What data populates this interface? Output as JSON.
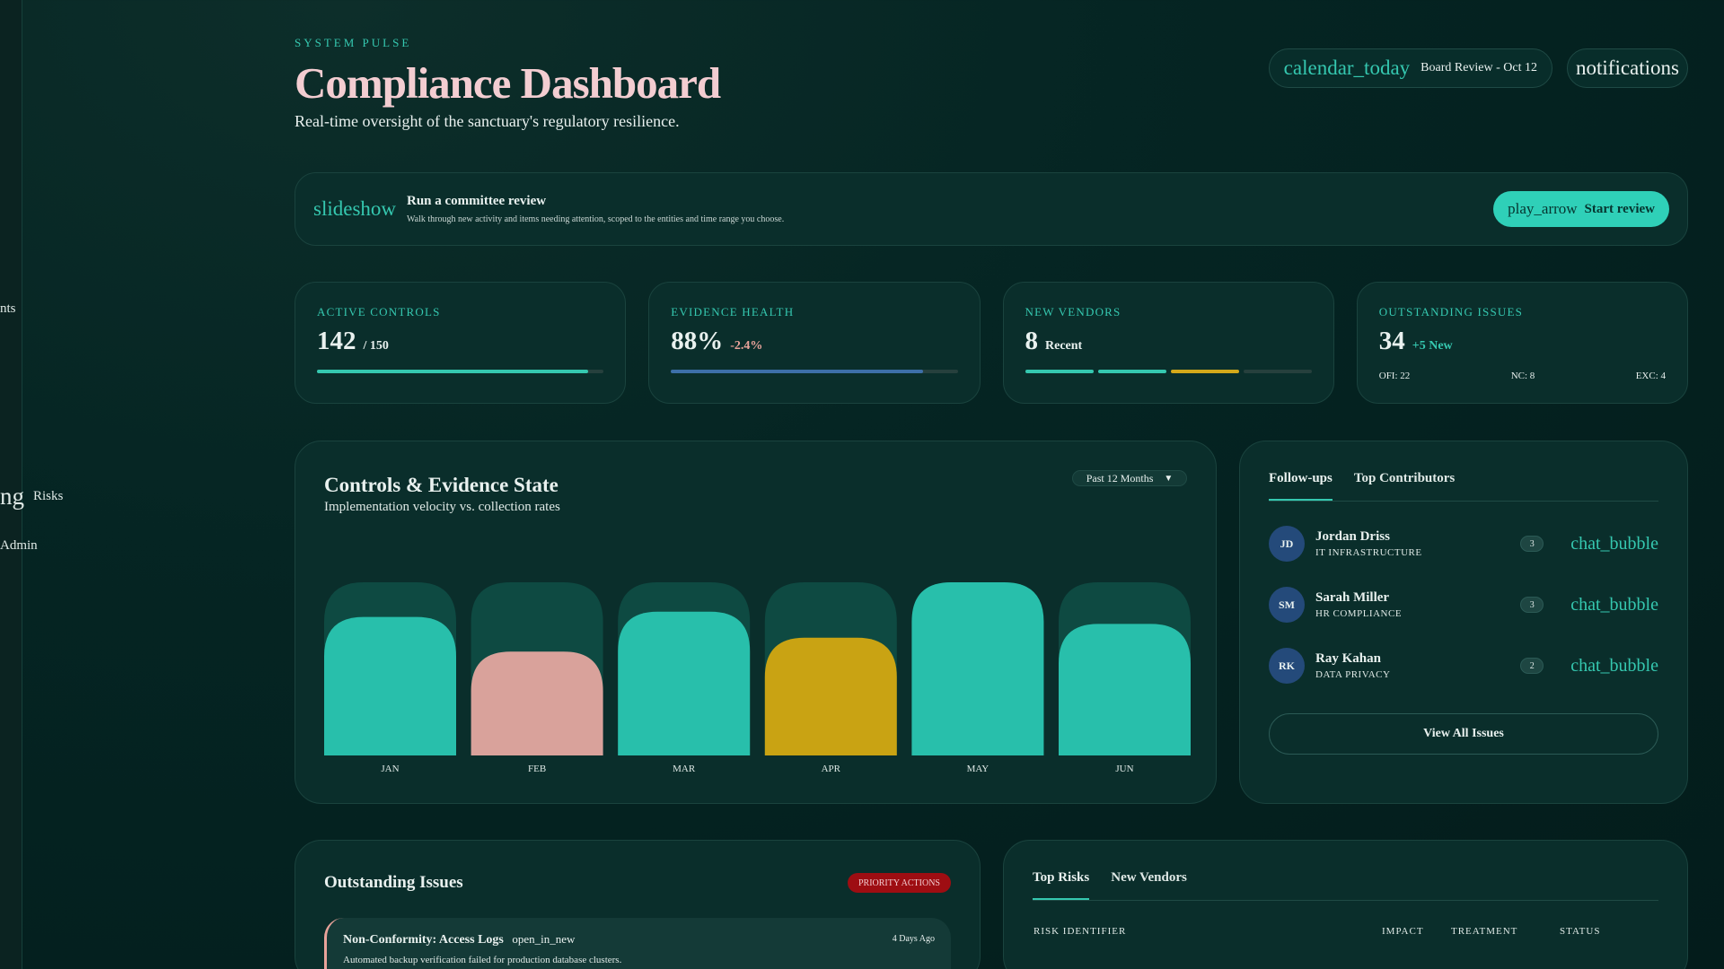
{
  "sidebar": {
    "items": [
      {
        "label": "nts"
      },
      {
        "icon": "ng",
        "label": "Risks"
      },
      {
        "label": "Admin"
      }
    ]
  },
  "header": {
    "eyebrow": "SYSTEM PULSE",
    "title": "Compliance Dashboard",
    "subtitle": "Real-time oversight of the sanctuary's regulatory resilience.",
    "calendar_icon": "calendar_today",
    "calendar_label": "Board Review - Oct 12",
    "notifications_icon": "notifications"
  },
  "review_banner": {
    "icon": "slideshow",
    "title": "Run a committee review",
    "description": "Walk through new activity and items needing attention, scoped to the entities and time range you choose.",
    "button_icon": "play_arrow",
    "button_label": "Start review"
  },
  "metrics": {
    "active_controls": {
      "label": "ACTIVE CONTROLS",
      "value": "142",
      "suffix": "/ 150",
      "progress": 0.947,
      "color": "#35c8b0"
    },
    "evidence_health": {
      "label": "EVIDENCE HEALTH",
      "value": "88%",
      "delta": "-2.4%",
      "progress": 0.88,
      "color": "#3d6fa8"
    },
    "new_vendors": {
      "label": "NEW VENDORS",
      "value": "8",
      "suffix": "Recent",
      "segment_colors": [
        "#35c8b0",
        "#35c8b0",
        "#d4a91a",
        "#26403d"
      ]
    },
    "outstanding_issues": {
      "label": "OUTSTANDING ISSUES",
      "value": "34",
      "delta": "+5 New",
      "breakdown": [
        "OFI: 22",
        "NC: 8",
        "EXC: 4"
      ]
    }
  },
  "chart_data": {
    "type": "bar",
    "title": "Controls & Evidence State",
    "subtitle": "Implementation velocity vs. collection rates",
    "range_label": "Past 12 Months",
    "categories": [
      "JAN",
      "FEB",
      "MAR",
      "APR",
      "MAY",
      "JUN"
    ],
    "values": [
      0.8,
      0.6,
      0.83,
      0.68,
      1.0,
      0.76
    ],
    "bar_colors": [
      "#28bfab",
      "#d9a29b",
      "#28bfab",
      "#c9a313",
      "#28bfab",
      "#28bfab"
    ],
    "track_color": "#0e4a42",
    "ylim": [
      0,
      1
    ]
  },
  "followups": {
    "tabs": [
      "Follow-ups",
      "Top Contributors"
    ],
    "people": [
      {
        "initials": "JD",
        "name": "Jordan Driss",
        "dept": "IT INFRASTRUCTURE",
        "count": "3",
        "icon": "chat_bubble"
      },
      {
        "initials": "SM",
        "name": "Sarah Miller",
        "dept": "HR COMPLIANCE",
        "count": "3",
        "icon": "chat_bubble"
      },
      {
        "initials": "RK",
        "name": "Ray Kahan",
        "dept": "DATA PRIVACY",
        "count": "2",
        "icon": "chat_bubble"
      }
    ],
    "view_all_label": "View All Issues"
  },
  "issues": {
    "title": "Outstanding Issues",
    "badge": "PRIORITY ACTIONS",
    "items": [
      {
        "name": "Non-Conformity: Access Logs",
        "icon": "open_in_new",
        "time": "4 Days Ago",
        "description": "Automated backup verification failed for production database clusters."
      }
    ]
  },
  "risks": {
    "tabs": [
      "Top Risks",
      "New Vendors"
    ],
    "columns": [
      "RISK IDENTIFIER",
      "IMPACT",
      "TREATMENT",
      "STATUS"
    ]
  }
}
